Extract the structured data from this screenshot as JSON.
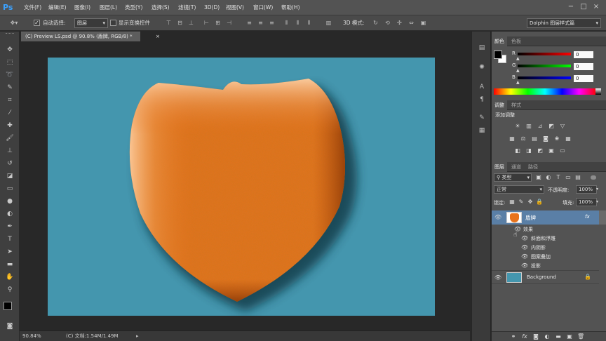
{
  "app": {
    "logo": "Ps"
  },
  "menu": [
    "文件(F)",
    "编辑(E)",
    "图像(I)",
    "图层(L)",
    "类型(Y)",
    "选择(S)",
    "滤镜(T)",
    "3D(D)",
    "视图(V)",
    "窗口(W)",
    "帮助(H)"
  ],
  "window_controls": [
    "−",
    "□",
    "×"
  ],
  "options": {
    "auto_select_label": "自动选择:",
    "auto_select_value": "图层",
    "show_transform_label": "显示变换控件",
    "mode_3d_label": "3D 模式:",
    "workspace": "Dolphin 图层样式篇"
  },
  "document": {
    "tab_title": "(C) Preview LS.psd @ 90.8% (盾牌, RGB/8) *",
    "tab_close": "×",
    "canvas_bg": "#4496ae",
    "shield_color": "#e8731c"
  },
  "status": {
    "zoom": "90.84%",
    "doc_info": "(C) 文档:1.54M/1.49M"
  },
  "color_panel": {
    "tabs": [
      "颜色",
      "色板"
    ],
    "channels": [
      {
        "label": "R",
        "value": "0"
      },
      {
        "label": "G",
        "value": "0"
      },
      {
        "label": "B",
        "value": "0"
      }
    ]
  },
  "adjust_panel": {
    "tabs": [
      "调整",
      "样式"
    ],
    "title": "添加调整"
  },
  "layers_panel": {
    "tabs": [
      "图层",
      "通道",
      "路径"
    ],
    "filter_kind": "类型",
    "blend_mode": "正常",
    "opacity_label": "不透明度:",
    "opacity_value": "100%",
    "lock_label": "锁定:",
    "fill_label": "填充:",
    "fill_value": "100%",
    "layers": [
      {
        "name": "盾牌",
        "fx": "fx",
        "effects_label": "效果",
        "effects": [
          "斜面和浮雕",
          "内阴影",
          "图案叠加",
          "投影"
        ]
      },
      {
        "name": "Background"
      }
    ]
  }
}
